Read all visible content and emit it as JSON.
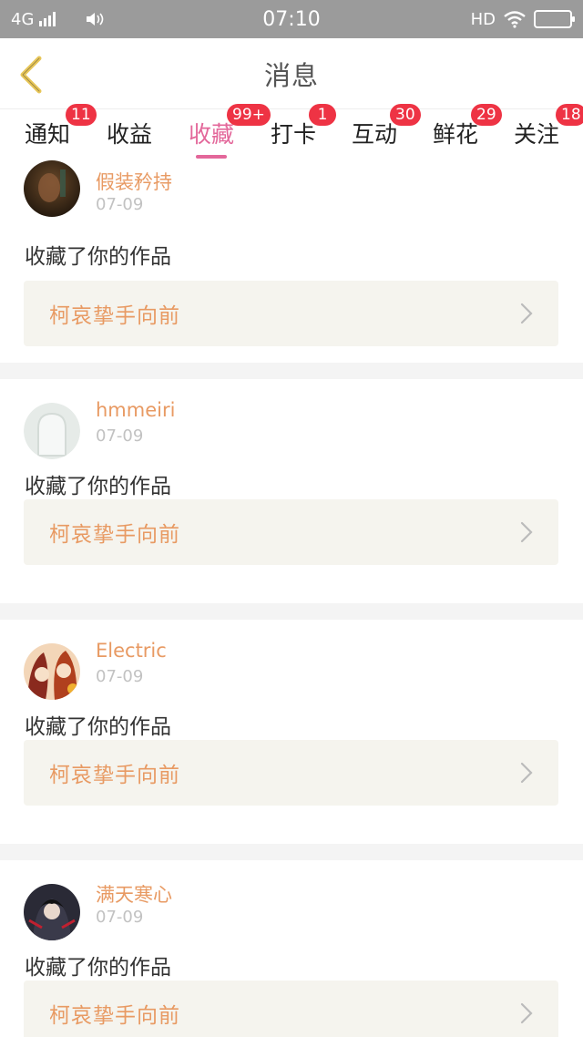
{
  "status_bar": {
    "network": "4G",
    "time": "07:10",
    "hd": "HD"
  },
  "header": {
    "title": "消息"
  },
  "tabs": [
    {
      "label": "通知",
      "badge": "11"
    },
    {
      "label": "收益",
      "badge": ""
    },
    {
      "label": "收藏",
      "badge": "99+",
      "active": true
    },
    {
      "label": "打卡",
      "badge": "1"
    },
    {
      "label": "互动",
      "badge": "30"
    },
    {
      "label": "鲜花",
      "badge": "29"
    },
    {
      "label": "关注",
      "badge": "18"
    }
  ],
  "feed": [
    {
      "username": "假装矜持",
      "time": "07-09",
      "action": "收藏了你的作品",
      "work_title": "柯哀挚手向前",
      "avatar_icon": "avatar-dark-photo"
    },
    {
      "username": "hmmeiri",
      "time": "07-09",
      "action": "收藏了你的作品",
      "work_title": "柯哀挚手向前",
      "avatar_icon": "default-avatar-icon"
    },
    {
      "username": "Electric",
      "time": "07-09",
      "action": "收藏了你的作品",
      "work_title": "柯哀挚手向前",
      "avatar_icon": "avatar-anime-girl"
    },
    {
      "username": "满天寒心",
      "time": "07-09",
      "action": "收藏了你的作品",
      "work_title": "柯哀挚手向前",
      "avatar_icon": "avatar-anime-boy"
    }
  ],
  "colors": {
    "accent": "#e3679a",
    "username": "#e89a63",
    "badge": "#ee3344",
    "back_arrow": "#e8c75a"
  }
}
